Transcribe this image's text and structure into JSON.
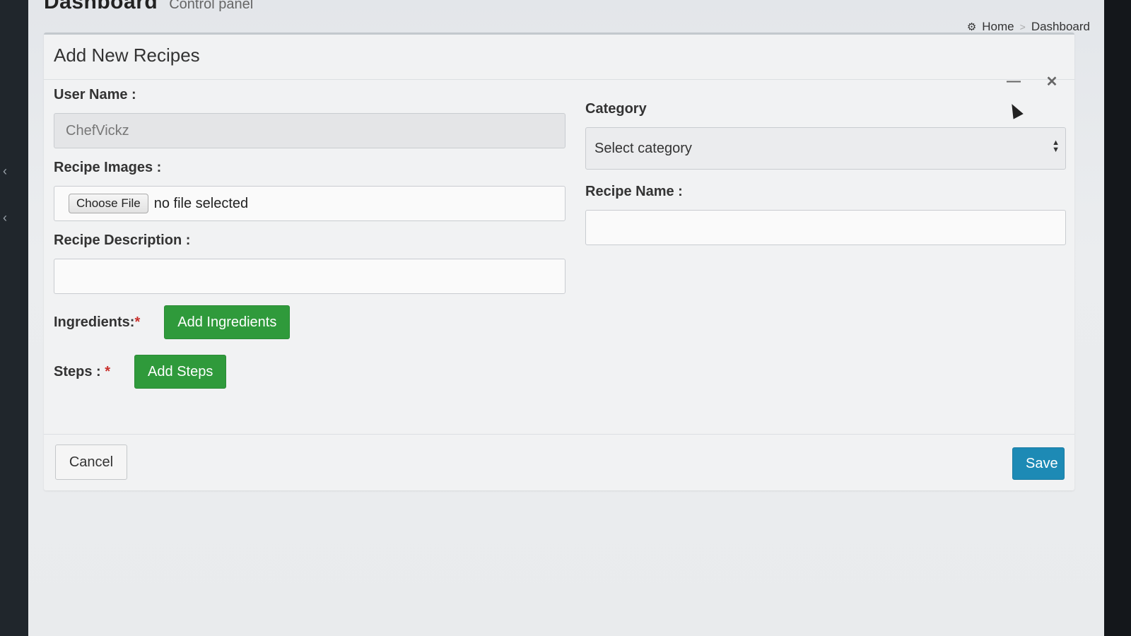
{
  "header": {
    "title": "Dashboard",
    "subtitle": "Control panel"
  },
  "breadcrumb": {
    "home_icon": "dashboard-icon",
    "home": "Home",
    "separator": ">",
    "current": "Dashboard"
  },
  "box": {
    "title": "Add New Recipes",
    "collapse_icon": "minus-icon",
    "close_icon": "close-icon"
  },
  "form": {
    "username": {
      "label": "User Name :",
      "value": "ChefVickz"
    },
    "category": {
      "label": "Category",
      "selected": "Select category"
    },
    "images": {
      "label": "Recipe Images :",
      "button": "Choose File",
      "status": "no file selected"
    },
    "recipe_name": {
      "label": "Recipe Name :",
      "value": ""
    },
    "description": {
      "label": "Recipe Description :",
      "value": ""
    },
    "ingredients": {
      "label": "Ingredients:",
      "required": "*",
      "button": "Add Ingredients"
    },
    "steps": {
      "label": "Steps :",
      "required": "*",
      "button": "Add Steps"
    }
  },
  "footer": {
    "cancel": "Cancel",
    "save": "Save"
  },
  "colors": {
    "success": "#2f9a3b",
    "primary": "#1d8ab5",
    "required": "#c9302c"
  }
}
